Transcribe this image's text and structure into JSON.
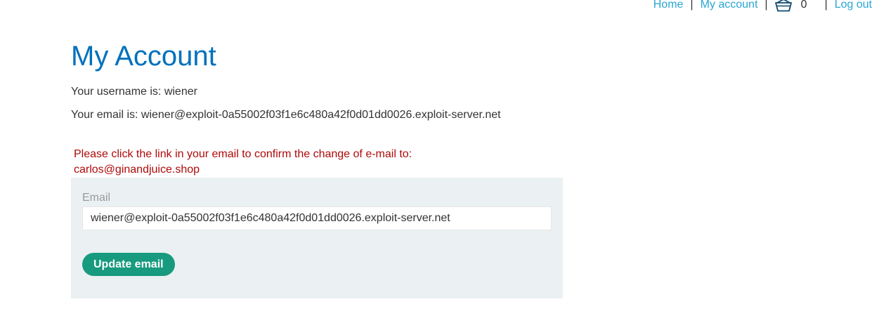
{
  "nav": {
    "home": "Home",
    "my_account": "My account",
    "cart_count": "0",
    "log_out": "Log out",
    "separator": "|",
    "cart_icon": "basket-icon"
  },
  "page": {
    "title": "My Account",
    "username_line": "Your username is: wiener",
    "email_line": "Your email is: wiener@exploit-0a55002f03f1e6c480a42f0d01dd0026.exploit-server.net",
    "notice_line1": "Please click the link in your email to confirm the change of e-mail to:",
    "notice_line2": "carlos@ginandjuice.shop"
  },
  "form": {
    "email_label": "Email",
    "email_value": "wiener@exploit-0a55002f03f1e6c480a42f0d01dd0026.exploit-server.net",
    "submit_label": "Update email"
  },
  "colors": {
    "link": "#29a6d3",
    "title": "#0071bc",
    "notice": "#ae0909",
    "button": "#179a7e",
    "panel": "#ebf0f2"
  }
}
